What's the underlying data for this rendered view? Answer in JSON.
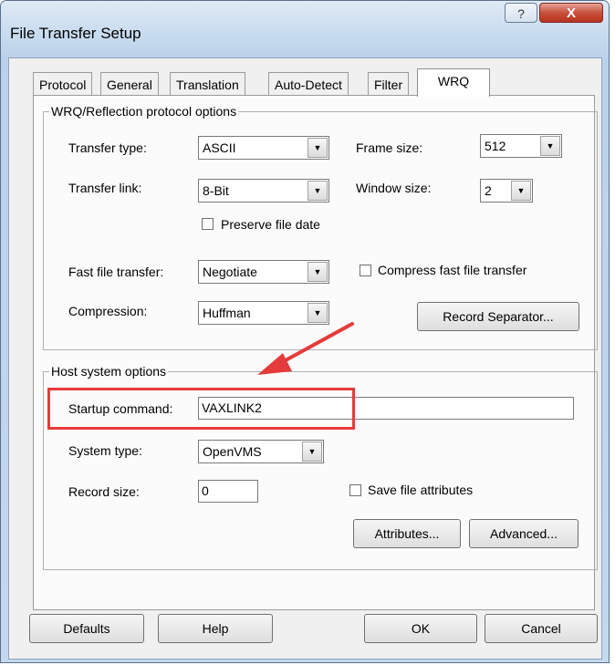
{
  "window": {
    "title": "File Transfer Setup",
    "help_glyph": "?",
    "close_glyph": "X"
  },
  "tabs": [
    {
      "label": "Protocol",
      "active": false
    },
    {
      "label": "General",
      "active": false
    },
    {
      "label": "Translation",
      "active": false
    },
    {
      "label": "Auto-Detect",
      "active": false
    },
    {
      "label": "Filter",
      "active": false
    },
    {
      "label": "WRQ",
      "active": true
    }
  ],
  "wrq_group": {
    "title": "WRQ/Reflection protocol options",
    "transfer_type": {
      "label": "Transfer type:",
      "value": "ASCII"
    },
    "transfer_link": {
      "label": "Transfer link:",
      "value": "8-Bit"
    },
    "frame_size": {
      "label": "Frame size:",
      "value": "512"
    },
    "window_size": {
      "label": "Window size:",
      "value": "2"
    },
    "preserve_file_date": {
      "label": "Preserve file date",
      "checked": false
    },
    "fast_file_transfer": {
      "label": "Fast file transfer:",
      "value": "Negotiate"
    },
    "compress_fast": {
      "label": "Compress fast file transfer",
      "checked": false
    },
    "compression": {
      "label": "Compression:",
      "value": "Huffman"
    },
    "record_separator_button": "Record Separator..."
  },
  "host_group": {
    "title": "Host system options",
    "startup_command": {
      "label": "Startup command:",
      "value": "VAXLINK2"
    },
    "system_type": {
      "label": "System type:",
      "value": "OpenVMS"
    },
    "record_size": {
      "label": "Record size:",
      "value": "0"
    },
    "save_file_attributes": {
      "label": "Save file attributes",
      "checked": false
    },
    "attributes_button": "Attributes...",
    "advanced_button": "Advanced..."
  },
  "footer": {
    "defaults_button": "Defaults",
    "help_button": "Help",
    "ok_button": "OK",
    "cancel_button": "Cancel"
  },
  "annotation": {
    "highlight_color": "#e53b3b"
  }
}
